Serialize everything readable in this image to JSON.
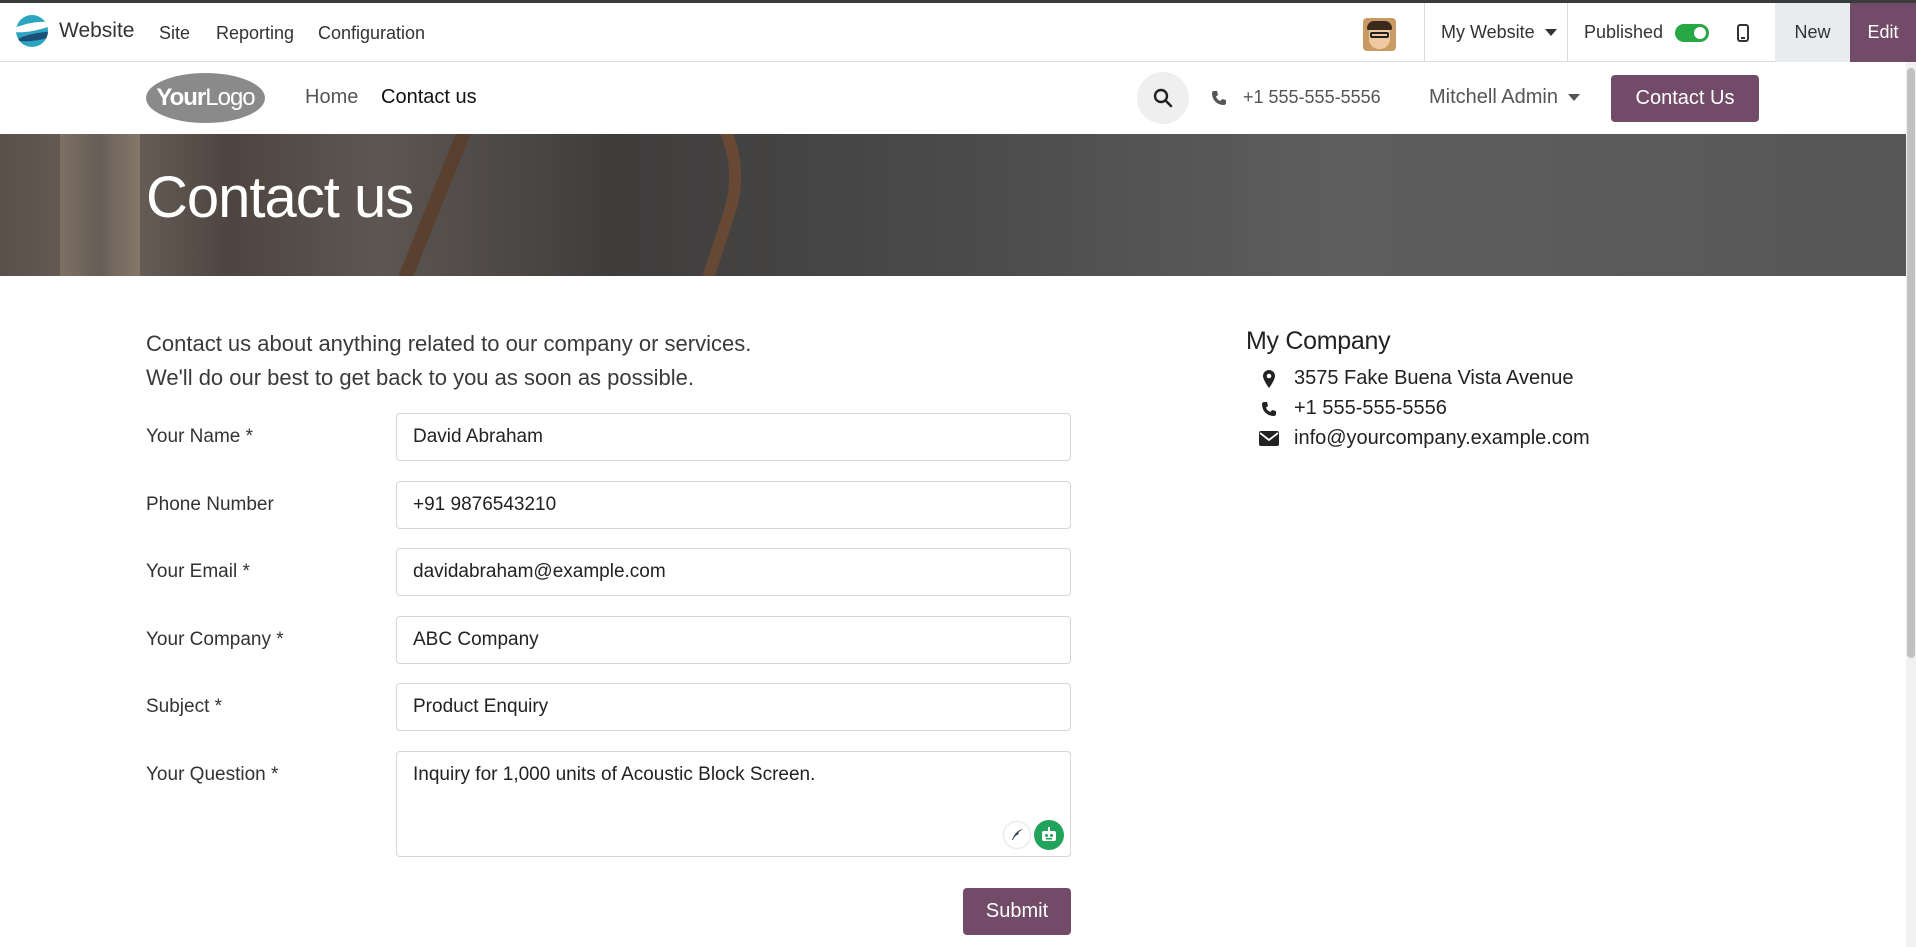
{
  "topbar": {
    "app_name": "Website",
    "menu": [
      "Site",
      "Reporting",
      "Configuration"
    ],
    "website_selector": "My Website",
    "published_label": "Published",
    "published": true,
    "new_label": "New",
    "edit_label": "Edit"
  },
  "header": {
    "logo_text_bold": "Your",
    "logo_text": "Logo",
    "nav": [
      "Home",
      "Contact us"
    ],
    "phone": "+1 555-555-5556",
    "user": "Mitchell Admin",
    "cta": "Contact Us"
  },
  "banner": {
    "title": "Contact us"
  },
  "intro": {
    "line1": "Contact us about anything related to our company or services.",
    "line2": "We'll do our best to get back to you as soon as possible."
  },
  "form": {
    "fields": [
      {
        "label": "Your Name *",
        "value": "David Abraham"
      },
      {
        "label": "Phone Number",
        "value": "+91 9876543210"
      },
      {
        "label": "Your Email *",
        "value": "davidabraham@example.com"
      },
      {
        "label": "Your Company *",
        "value": "ABC Company"
      },
      {
        "label": "Subject *",
        "value": "Product Enquiry"
      },
      {
        "label": "Your Question *",
        "value": "Inquiry for 1,000 units of Acoustic Block Screen."
      }
    ],
    "submit": "Submit"
  },
  "company": {
    "name": "My Company",
    "address": "3575 Fake Buena Vista Avenue",
    "phone": "+1 555-555-5556",
    "email": "info@yourcompany.example.com"
  },
  "colors": {
    "brand": "#714b67",
    "toggle_on": "#28a745"
  }
}
